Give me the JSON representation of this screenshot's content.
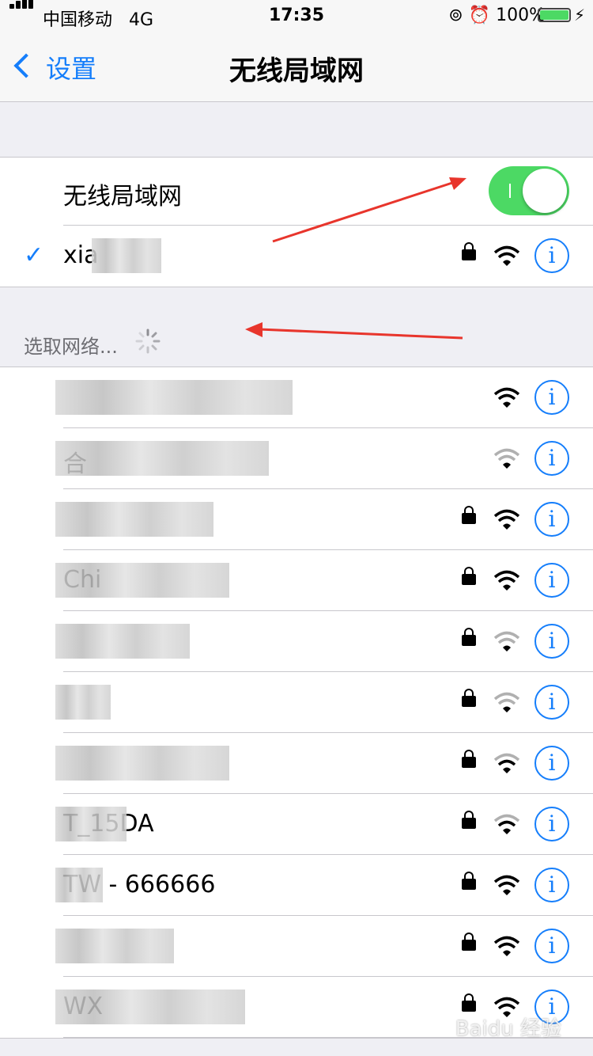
{
  "status_bar": {
    "carrier": "中国移动",
    "network": "4G",
    "time": "17:35",
    "battery": "100%"
  },
  "nav": {
    "back_label": "设置",
    "title": "无线局域网"
  },
  "wifi_toggle": {
    "label": "无线局域网",
    "on": true
  },
  "connected": {
    "name": "xia",
    "locked": true,
    "signal": "full"
  },
  "section_header": "选取网络...",
  "networks": [
    {
      "name": "",
      "locked": false,
      "signal": "full"
    },
    {
      "name": "合",
      "locked": false,
      "signal": "weak"
    },
    {
      "name": "",
      "locked": true,
      "signal": "full"
    },
    {
      "name": "Chi",
      "locked": true,
      "signal": "full"
    },
    {
      "name": "",
      "locked": true,
      "signal": "weak"
    },
    {
      "name": "",
      "locked": true,
      "signal": "weak"
    },
    {
      "name": "",
      "locked": true,
      "signal": "medium"
    },
    {
      "name": "T_15DA",
      "locked": true,
      "signal": "medium"
    },
    {
      "name": "TW - 666666",
      "locked": true,
      "signal": "full"
    },
    {
      "name": "",
      "locked": true,
      "signal": "full"
    },
    {
      "name": "WX",
      "locked": true,
      "signal": "full"
    }
  ],
  "colors": {
    "accent": "#157efb",
    "toggle_on": "#4cd964",
    "annotation": "#e8352c"
  },
  "icons": [
    "signal-icon",
    "lock-rotation-icon",
    "alarm-icon",
    "battery-icon",
    "back-chevron-icon",
    "checkmark-icon",
    "lock-icon",
    "wifi-icon",
    "info-icon",
    "spinner-icon"
  ],
  "watermark": "Baidu 经验"
}
